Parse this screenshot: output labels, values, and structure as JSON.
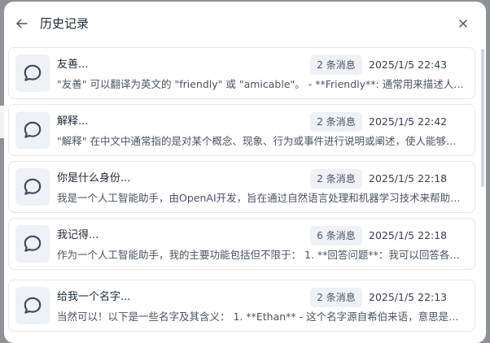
{
  "header": {
    "title": "历史记录"
  },
  "conversations": [
    {
      "title": "友善...",
      "badge": "2 条消息",
      "time": "2025/1/5 22:43",
      "preview": "\"友善\" 可以翻译为英文的 \"friendly\" 或 \"amicable\"。 - **Friendly**: 通常用来描述人的性格或行为友好"
    },
    {
      "title": "解释...",
      "badge": "2 条消息",
      "time": "2025/1/5 22:42",
      "preview": "\"解释\" 在中文中通常指的是对某个概念、现象、行为或事件进行说明或阐述，使人能够理解"
    },
    {
      "title": "你是什么身份...",
      "badge": "2 条消息",
      "time": "2025/1/5 22:18",
      "preview": "我是一个人工智能助手，由OpenAI开发，旨在通过自然语言处理和机器学习技术来帮助回答问题"
    },
    {
      "title": "我记得...",
      "badge": "6 条消息",
      "time": "2025/1/5 22:18",
      "preview": "作为一个人工智能助手，我的主要功能包括但不限于： 1. **回答问题**：我可以回答各种问题"
    },
    {
      "title": "给我一个名字...",
      "badge": "2 条消息",
      "time": "2025/1/5 22:13",
      "preview": "当然可以！以下是一些名字及其含义： 1. **Ethan** - 这个名字源自希伯来语，意思是坚强"
    }
  ],
  "icons": {
    "back": "arrow-left-icon",
    "close": "close-icon",
    "conversation": "chat-bubble-icon"
  },
  "colors": {
    "overlay": "#8e9196",
    "card_border": "#e5e7eb",
    "avatar_bg": "#eef1f6",
    "text_primary": "#1f2937",
    "text_secondary": "#4b5563"
  }
}
